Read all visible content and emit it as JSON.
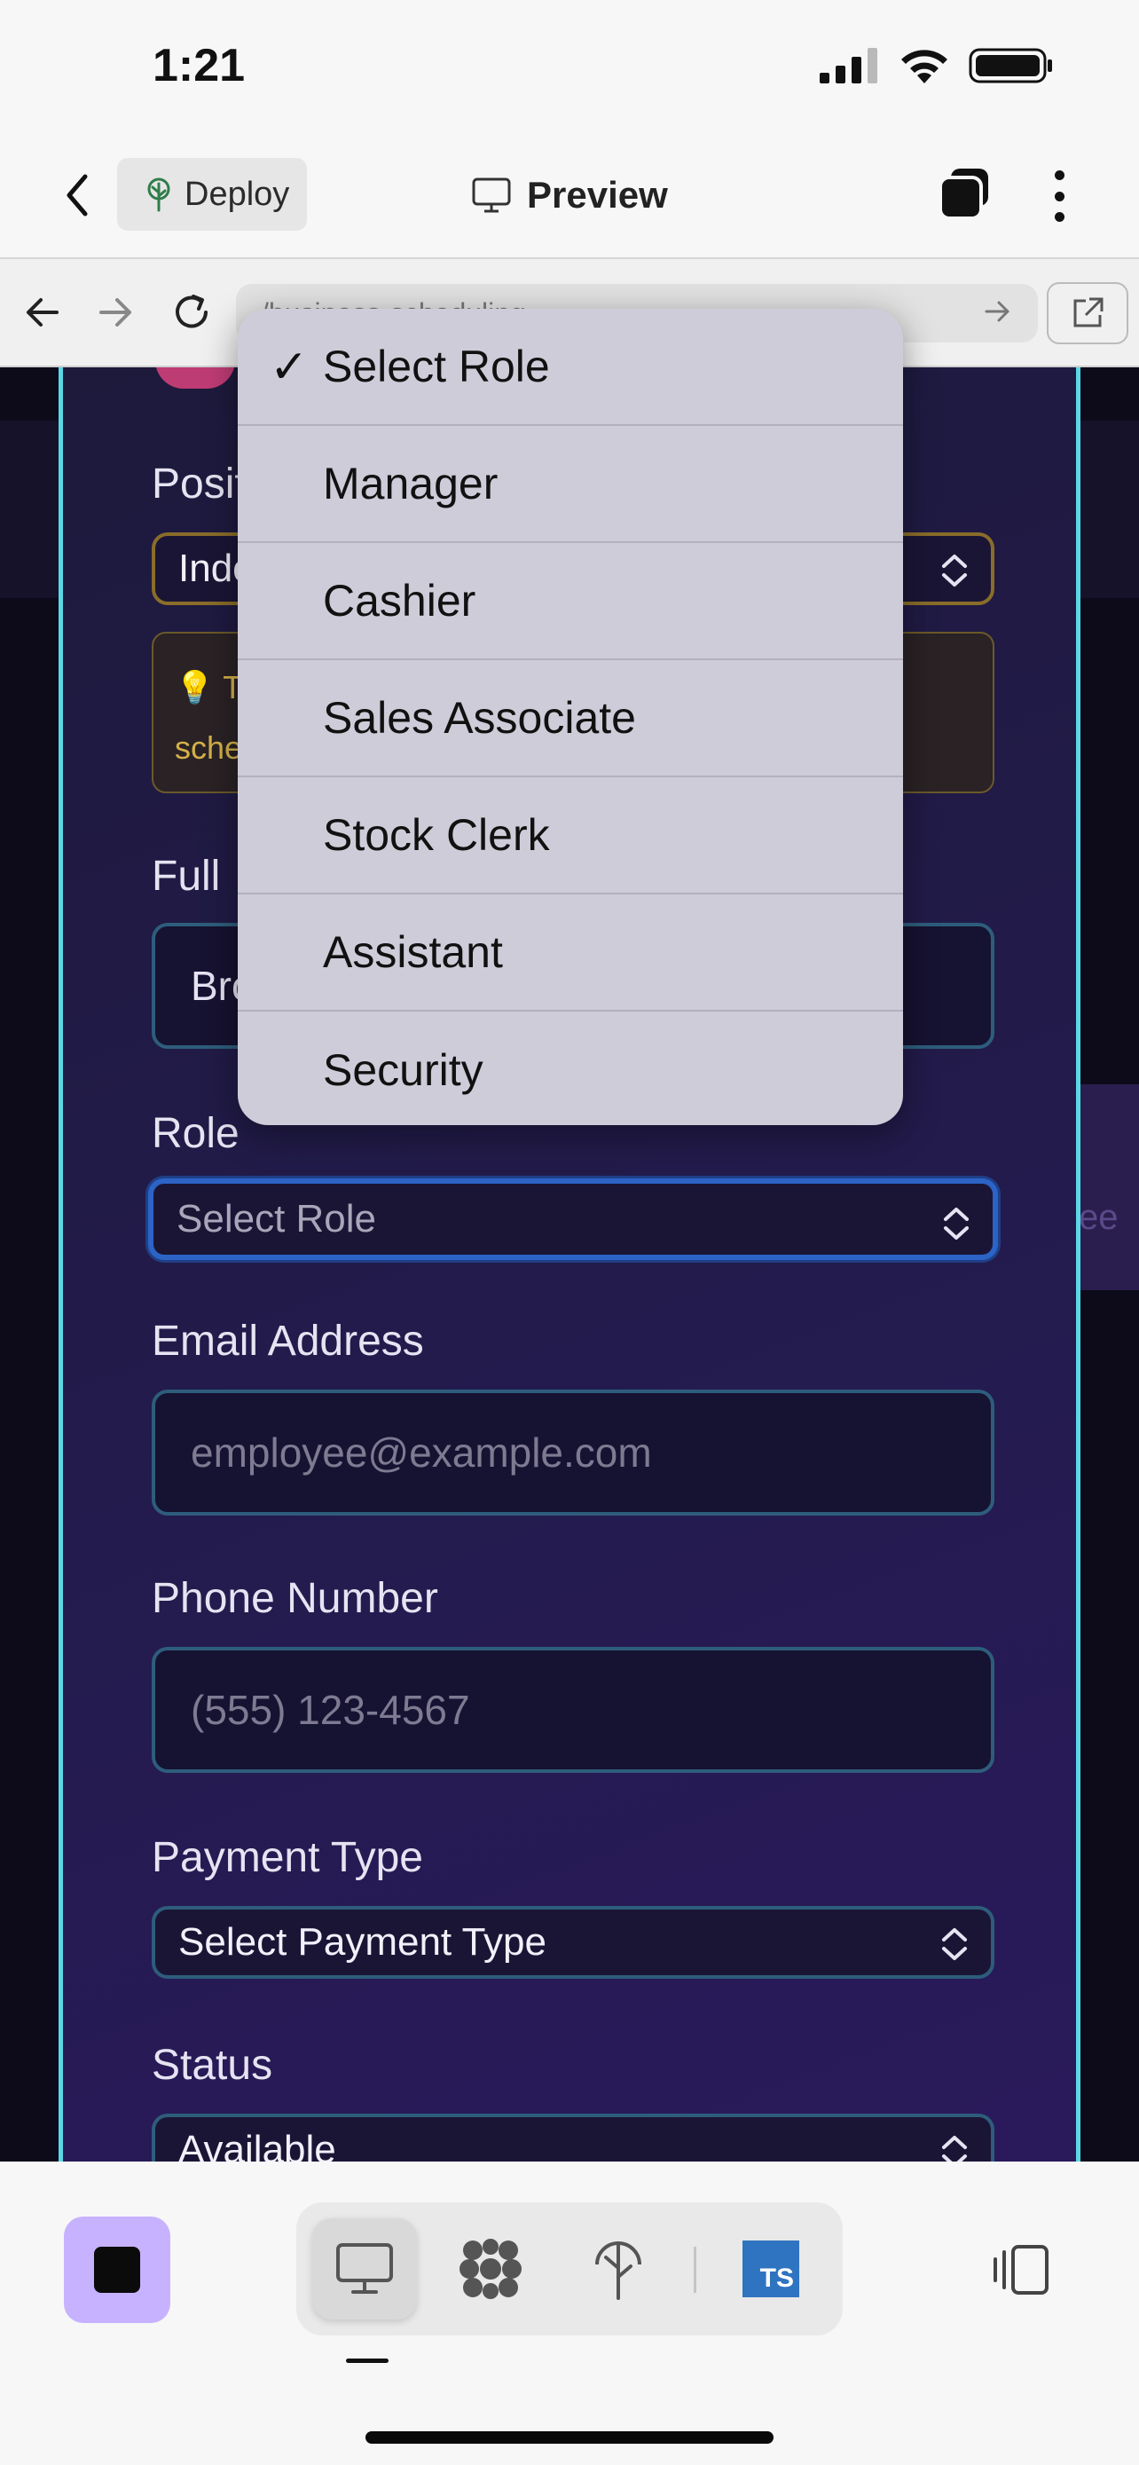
{
  "status_bar": {
    "time": "1:21"
  },
  "header": {
    "deploy_label": "Deploy",
    "preview_label": "Preview"
  },
  "browser": {
    "url": "/business-scheduling"
  },
  "form": {
    "position_label": "Posit",
    "position_value": "Inde",
    "tip_line1": "T",
    "tip_line2": "sche",
    "full_name_label": "Full",
    "full_name_value": "Bro",
    "role_label": "Role",
    "role_value": "Select Role",
    "email_label": "Email Address",
    "email_placeholder": "employee@example.com",
    "phone_label": "Phone Number",
    "phone_placeholder": "(555) 123-4567",
    "payment_label": "Payment Type",
    "payment_value": "Select Payment Type",
    "status_label": "Status",
    "status_value": "Available",
    "bg_partial_text": "ee"
  },
  "dropdown": {
    "selected": "Select Role",
    "options": [
      "Select Role",
      "Manager",
      "Cashier",
      "Sales Associate",
      "Stock Clerk",
      "Assistant",
      "Security"
    ]
  },
  "toolbar": {
    "ts_badge": "TS",
    "icons": [
      "stop-icon",
      "desktop-icon",
      "cluster-icon",
      "deploy-tree-icon",
      "typescript-icon",
      "layout-icon"
    ]
  }
}
